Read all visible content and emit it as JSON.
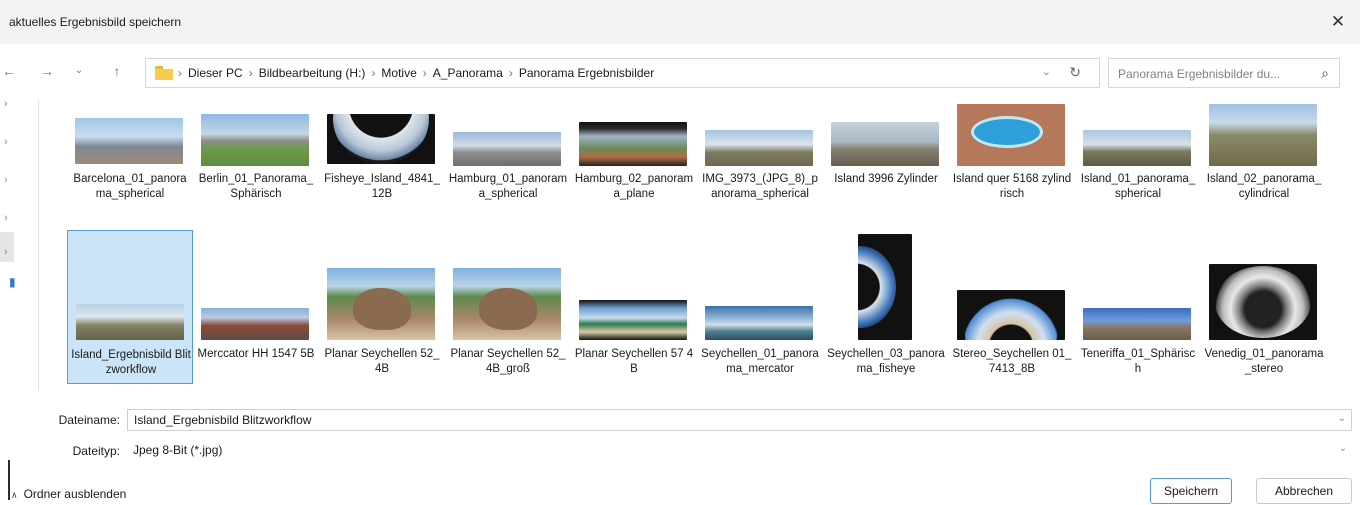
{
  "window": {
    "title": "aktuelles Ergebnisbild speichern",
    "close_label": "✕"
  },
  "nav": {
    "back_icon": "arrow-left-icon",
    "forward_icon": "arrow-right-icon",
    "recent_icon": "chevron-down-icon",
    "up_icon": "arrow-up-icon"
  },
  "address": {
    "crumbs": [
      "Dieser PC",
      "Bildbearbeitung (H:)",
      "Motive",
      "A_Panorama",
      "Panorama Ergebnisbilder"
    ],
    "separator": "›"
  },
  "search": {
    "placeholder": "Panorama Ergebnisbilder du..."
  },
  "files": [
    {
      "name": "Barcelona_01_panorama_spherical"
    },
    {
      "name": "Berlin_01_Panorama_Sphärisch"
    },
    {
      "name": "Fisheye_Island_4841_12B"
    },
    {
      "name": "Hamburg_01_panorama_spherical"
    },
    {
      "name": "Hamburg_02_panorama_plane"
    },
    {
      "name": "IMG_3973_(JPG_8)_panorama_spherical"
    },
    {
      "name": "Island 3996 Zylinder"
    },
    {
      "name": "Island quer 5168 zylindrisch"
    },
    {
      "name": "Island_01_panorama_spherical"
    },
    {
      "name": "Island_02_panorama_cylindrical"
    },
    {
      "name": "Island_Ergebnisbild Blitzworkflow"
    },
    {
      "name": "Merccator HH 1547 5B"
    },
    {
      "name": "Planar Seychellen 52_4B"
    },
    {
      "name": "Planar Seychellen 52_4B_groß"
    },
    {
      "name": "Planar Seychellen 57 4B"
    },
    {
      "name": "Seychellen_01_panorama_mercator"
    },
    {
      "name": "Seychellen_03_panorama_fisheye"
    },
    {
      "name": "Stereo_Seychellen 01_7413_8B"
    },
    {
      "name": "Teneriffa_01_Sphärisch"
    },
    {
      "name": "Venedig_01_panorama_stereo"
    }
  ],
  "form": {
    "filename_label": "Dateiname:",
    "filename_value": "Island_Ergebnisbild Blitzworkflow",
    "filetype_label": "Dateityp:",
    "filetype_value": "Jpeg 8-Bit (*.jpg)"
  },
  "footer": {
    "toggle_label": "Ordner ausblenden",
    "save_label": "Speichern",
    "cancel_label": "Abbrechen"
  },
  "colors": {
    "selection_bg": "#cce4f7",
    "selection_border": "#5b9bd5",
    "folder": "#f7cd51"
  }
}
